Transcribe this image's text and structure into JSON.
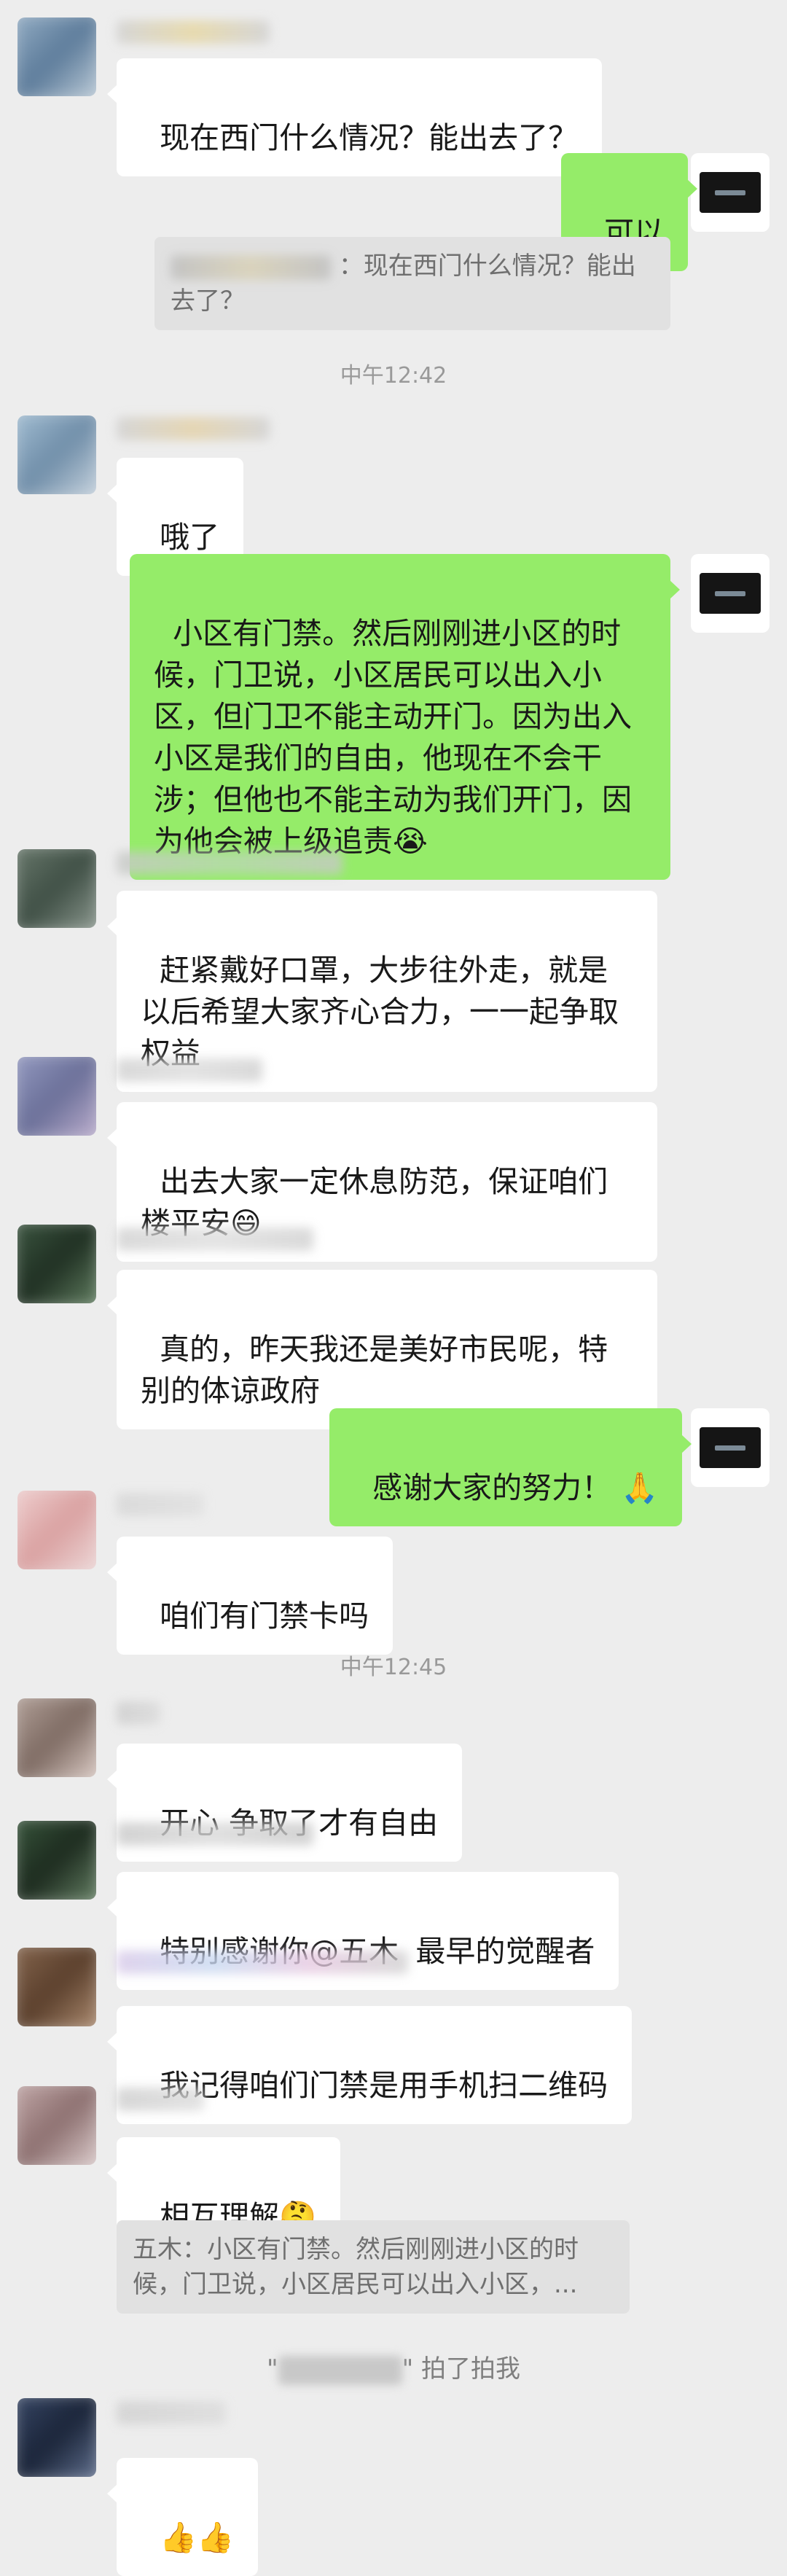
{
  "messages": {
    "m1": "现在西门什么情况？能出去了？",
    "m2": "可以",
    "m2_quote": "：现在西门什么情况？能出去了？",
    "time1": "中午12:42",
    "m3": "哦了",
    "m4": "小区有门禁。然后刚刚进小区的时候，门卫说，小区居民可以出入小区，但门卫不能主动开门。因为出入小区是我们的自由，他现在不会干涉；但他也不能主动为我们开门，因为他会被上级追责",
    "m4_emoji": "😭",
    "m5": "赶紧戴好口罩，大步往外走，就是以后希望大家齐心合力，一一起争取权益",
    "m6": "出去大家一定休息防范，保证咱们楼平安",
    "m6_emoji": "😄",
    "m7": "真的，昨天我还是美好市民呢，特别的体谅政府",
    "m8": "感谢大家的努力！",
    "m8_emoji": "🙏",
    "m9": "咱们有门禁卡吗",
    "time2": "中午12:45",
    "m10": "开心 争取了才有自由",
    "m11": "特别感谢你@五木  最早的觉醒者",
    "m12": "我记得咱们门禁是用手机扫二维码",
    "m13": "相互理解",
    "m13_emoji": "🤔",
    "m13_quote": "五木：小区有门禁。然后刚刚进小区的时候，门卫说，小区居民可以出入小区，...",
    "pat_prefix": "\"",
    "pat_suffix": "\" 拍了拍我",
    "m14": "👍👍"
  },
  "icons": {
    "self_avatar": "screen-thumbnail-icon",
    "blurred_avatars": "blurred-avatar"
  },
  "colors": {
    "background": "#ededed",
    "bubble_out": "#95ec69",
    "bubble_in": "#ffffff",
    "quote_bg": "#e1e1e1"
  }
}
